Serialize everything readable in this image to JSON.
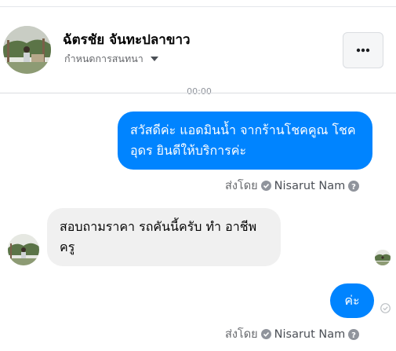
{
  "header": {
    "name": "ฉัตรชัย จันทะปลาขาว",
    "subtitle": "กำหนดการสนทนา",
    "more_label": "•••"
  },
  "time_hint": "00:00",
  "messages": [
    {
      "direction": "outgoing",
      "text": "สวัสดีค่ะ แอดมินน้ำ จากร้านโชคคูณ โชคอุดร ยินดีให้บริการค่ะ",
      "sent_by_label": "ส่งโดย",
      "sent_by_name": "Nisarut Nam"
    },
    {
      "direction": "incoming",
      "text": "สอบถามราคา รถคันนี้ครับ ทำ อาชีพครู"
    },
    {
      "direction": "outgoing",
      "text": "ค่ะ",
      "sent_by_label": "ส่งโดย",
      "sent_by_name": "Nisarut Nam"
    }
  ],
  "colors": {
    "outgoing_bubble": "#0084ff",
    "incoming_bubble": "#f0f0f0",
    "secondary_text": "#65676b"
  },
  "icons": [
    "profile-avatar",
    "dropdown-caret-icon",
    "more-icon",
    "verified-check-icon",
    "help-icon",
    "delivered-icon"
  ]
}
